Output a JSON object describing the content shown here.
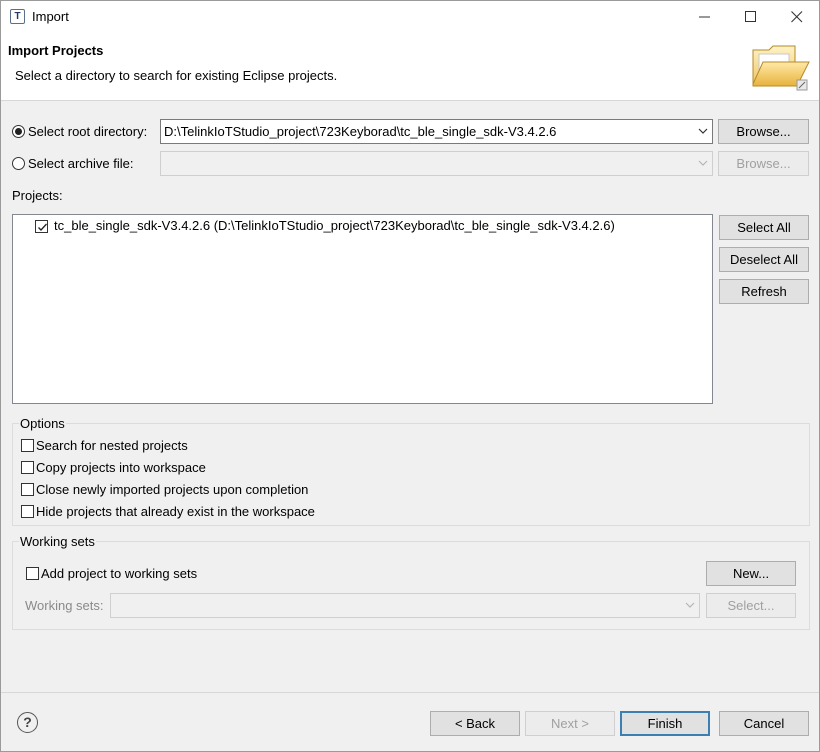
{
  "window": {
    "title": "Import",
    "app_icon_letter": "T"
  },
  "header": {
    "title": "Import Projects",
    "description": "Select a directory to search for existing Eclipse projects.",
    "icon": "folder-open-icon"
  },
  "source": {
    "root_dir_label": "Select root directory:",
    "root_dir_value": "D:\\TelinkIoTStudio_project\\723Keyborad\\tc_ble_single_sdk-V3.4.2.6",
    "root_dir_selected": true,
    "archive_label": "Select archive file:",
    "archive_value": "",
    "browse_label": "Browse...",
    "browse_archive_label": "Browse..."
  },
  "projects": {
    "label": "Projects:",
    "items": [
      {
        "label": "tc_ble_single_sdk-V3.4.2.6 (D:\\TelinkIoTStudio_project\\723Keyborad\\tc_ble_single_sdk-V3.4.2.6)",
        "checked": true
      }
    ],
    "select_all": "Select All",
    "deselect_all": "Deselect All",
    "refresh": "Refresh"
  },
  "options": {
    "title": "Options",
    "items": [
      {
        "label": "Search for nested projects",
        "checked": false
      },
      {
        "label": "Copy projects into workspace",
        "checked": false
      },
      {
        "label": "Close newly imported projects upon completion",
        "checked": false
      },
      {
        "label": "Hide projects that already exist in the workspace",
        "checked": false
      }
    ]
  },
  "working_sets": {
    "title": "Working sets",
    "add_label": "Add project to working sets",
    "add_checked": false,
    "new_button": "New...",
    "sets_label": "Working sets:",
    "sets_value": "",
    "select_button": "Select..."
  },
  "footer": {
    "back": "< Back",
    "next": "Next >",
    "finish": "Finish",
    "cancel": "Cancel"
  },
  "colors": {
    "default_button_border": "#3c7fb1",
    "window_bg": "#f0f0f0"
  }
}
